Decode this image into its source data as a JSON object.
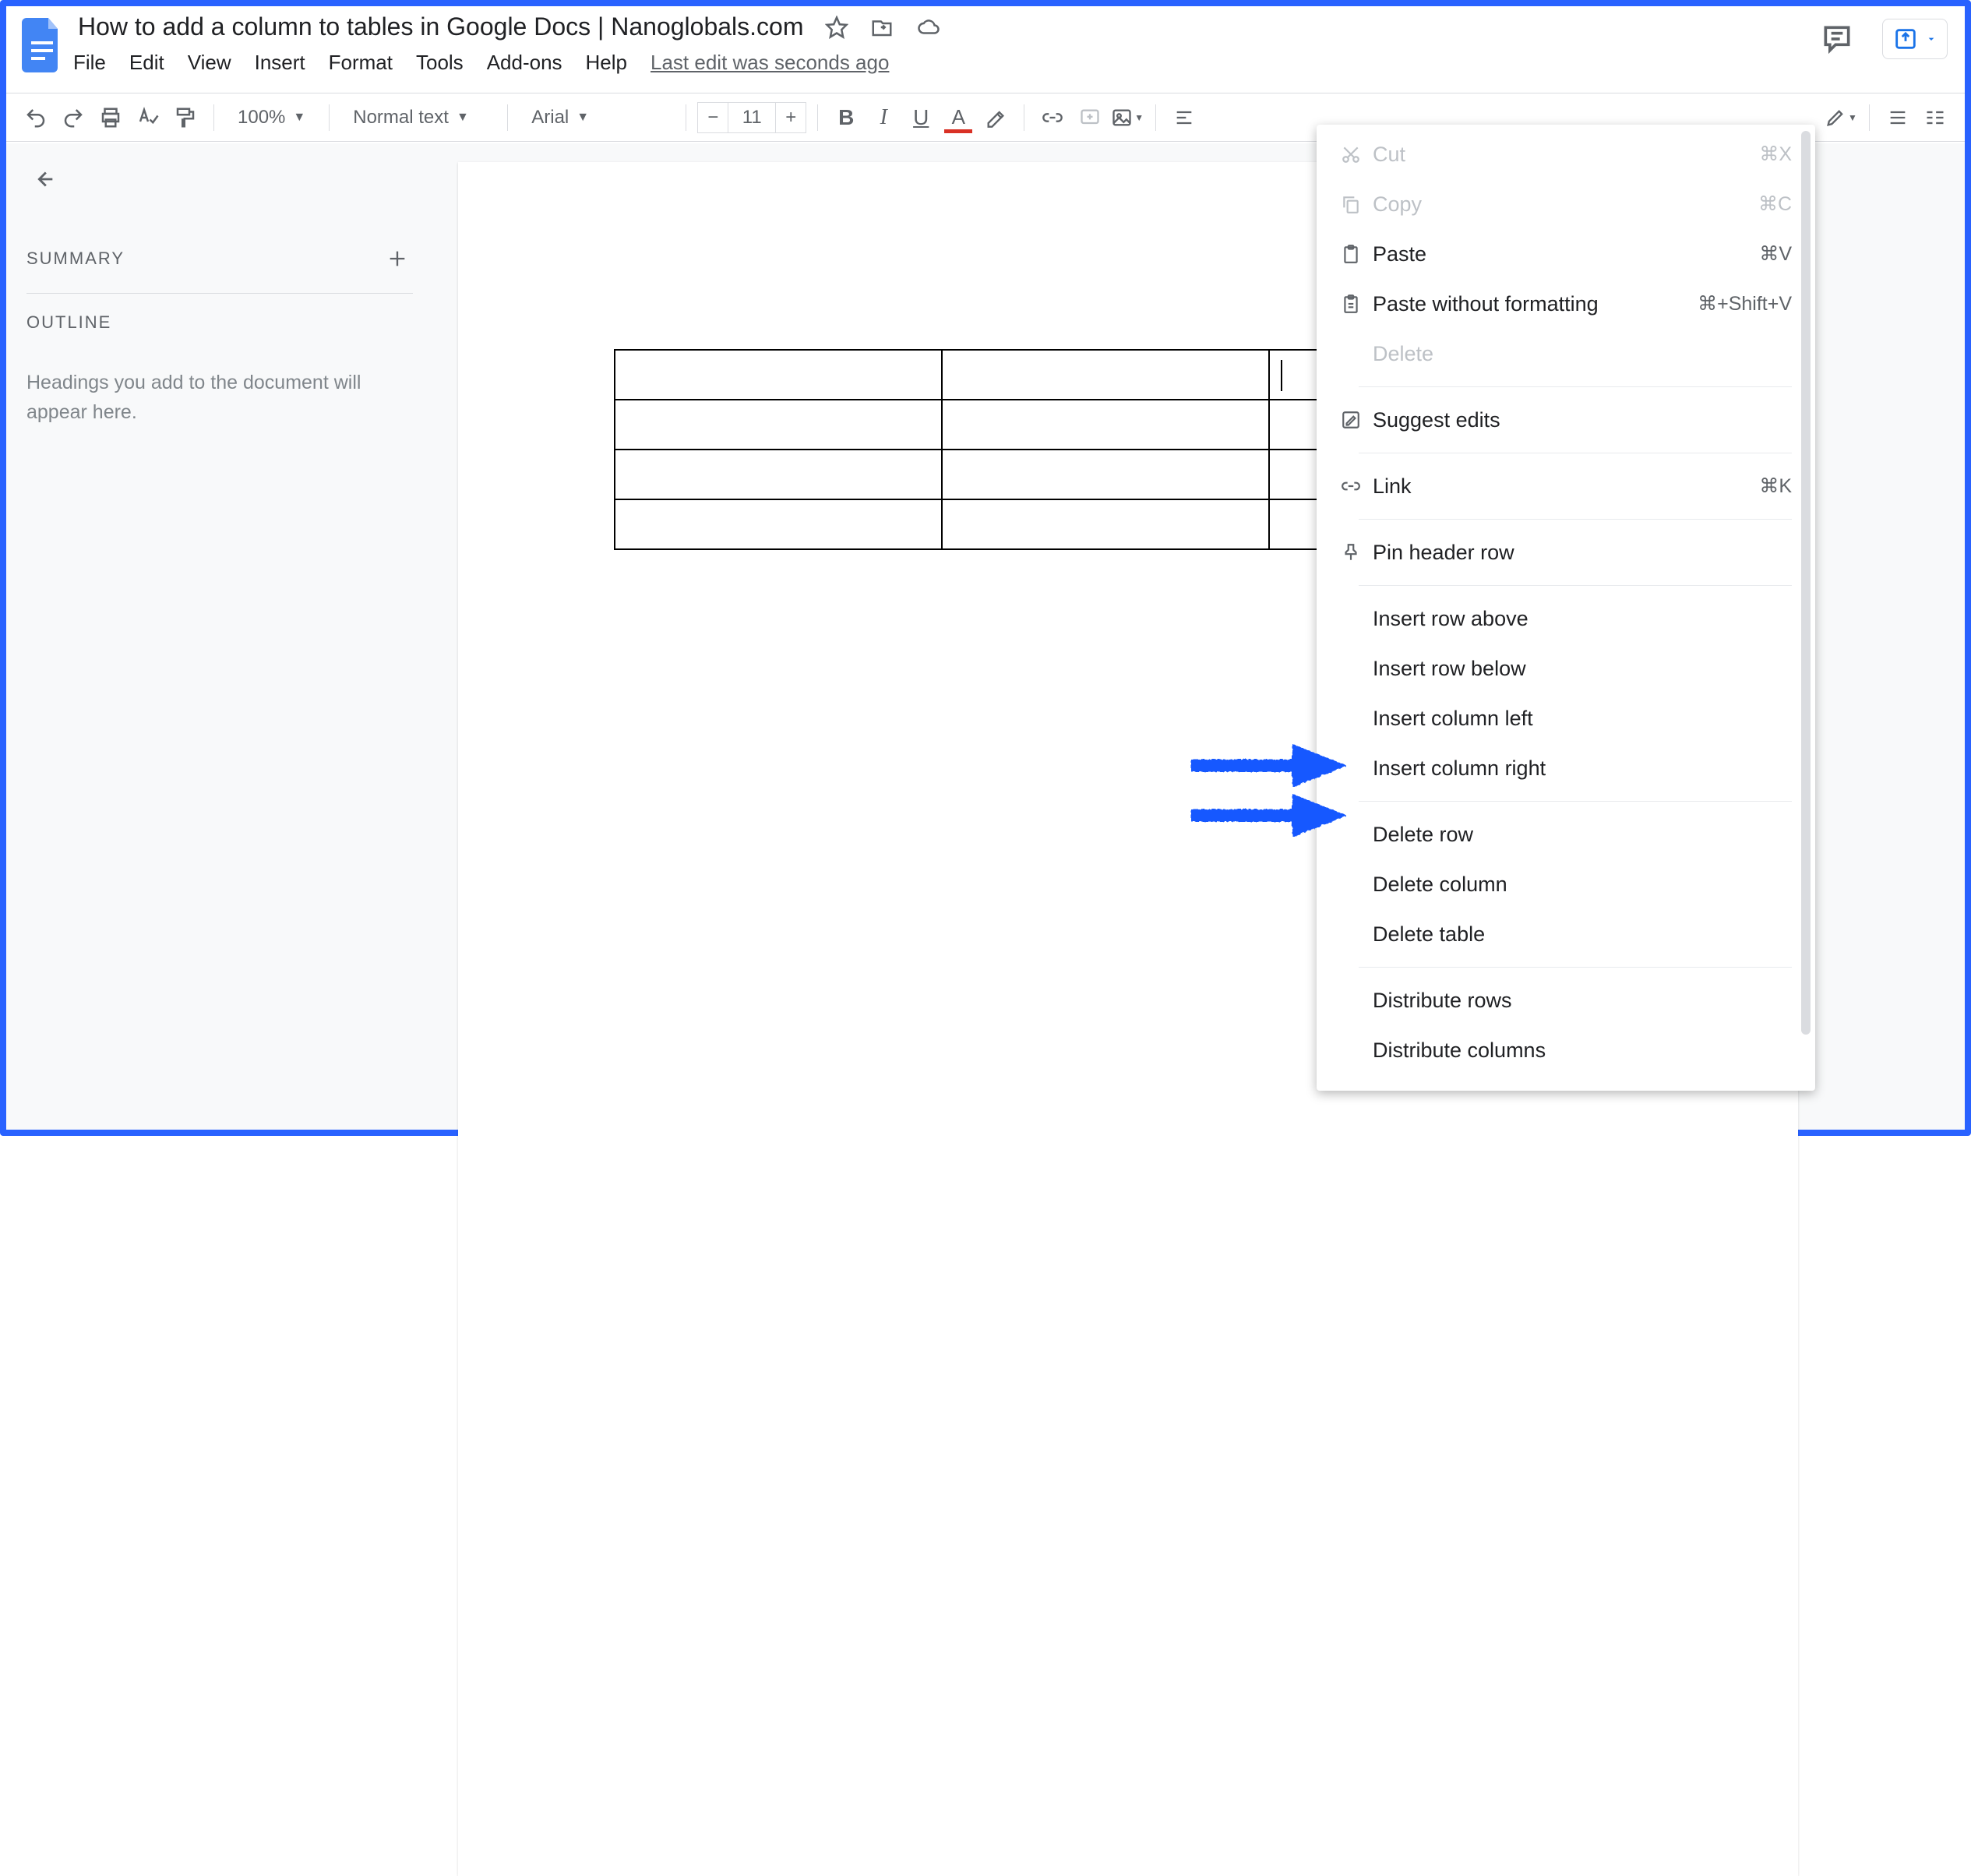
{
  "header": {
    "doc_title": "How to add a column to tables in Google Docs | Nanoglobals.com",
    "menu": [
      "File",
      "Edit",
      "View",
      "Insert",
      "Format",
      "Tools",
      "Add-ons",
      "Help"
    ],
    "last_edit": "Last edit was seconds ago"
  },
  "toolbar": {
    "zoom": "100%",
    "style": "Normal text",
    "font": "Arial",
    "font_size": "11"
  },
  "outline": {
    "summary_label": "SUMMARY",
    "outline_label": "OUTLINE",
    "hint": "Headings you add to the document will appear here."
  },
  "context_menu": {
    "groups": [
      [
        {
          "icon": "cut",
          "label": "Cut",
          "shortcut": "⌘X",
          "disabled": true
        },
        {
          "icon": "copy",
          "label": "Copy",
          "shortcut": "⌘C",
          "disabled": true
        },
        {
          "icon": "paste",
          "label": "Paste",
          "shortcut": "⌘V"
        },
        {
          "icon": "paste-plain",
          "label": "Paste without formatting",
          "shortcut": "⌘+Shift+V"
        },
        {
          "icon": "",
          "label": "Delete",
          "shortcut": "",
          "disabled": true
        }
      ],
      [
        {
          "icon": "suggest",
          "label": "Suggest edits"
        }
      ],
      [
        {
          "icon": "link",
          "label": "Link",
          "shortcut": "⌘K"
        }
      ],
      [
        {
          "icon": "pin",
          "label": "Pin header row"
        }
      ],
      [
        {
          "icon": "",
          "label": "Insert row above"
        },
        {
          "icon": "",
          "label": "Insert row below"
        },
        {
          "icon": "",
          "label": "Insert column left"
        },
        {
          "icon": "",
          "label": "Insert column right"
        }
      ],
      [
        {
          "icon": "",
          "label": "Delete row"
        },
        {
          "icon": "",
          "label": "Delete column"
        },
        {
          "icon": "",
          "label": "Delete table"
        }
      ],
      [
        {
          "icon": "",
          "label": "Distribute rows"
        },
        {
          "icon": "",
          "label": "Distribute columns"
        }
      ]
    ]
  }
}
